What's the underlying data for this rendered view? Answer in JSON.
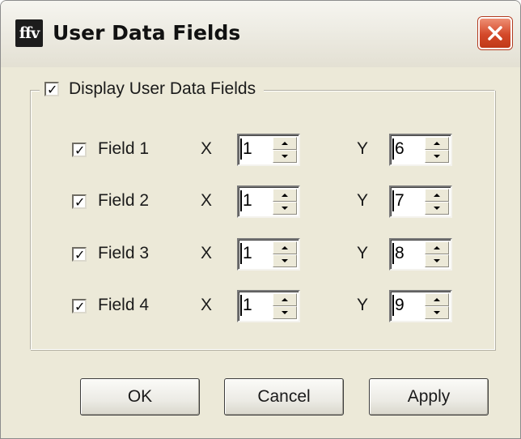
{
  "window": {
    "title": "User Data Fields",
    "app_icon_text": "ffv",
    "close_icon": "close-x-icon"
  },
  "group": {
    "label": "Display User Data Fields",
    "checked": true,
    "check_mark": "✓"
  },
  "labels": {
    "x": "X",
    "y": "Y"
  },
  "fields": [
    {
      "label": "Field 1",
      "checked": true,
      "x": "1",
      "y": "6"
    },
    {
      "label": "Field 2",
      "checked": true,
      "x": "1",
      "y": "7"
    },
    {
      "label": "Field 3",
      "checked": true,
      "x": "1",
      "y": "8"
    },
    {
      "label": "Field 4",
      "checked": true,
      "x": "1",
      "y": "9"
    }
  ],
  "buttons": {
    "ok": "OK",
    "cancel": "Cancel",
    "apply": "Apply"
  },
  "colors": {
    "dialog_bg": "#ece9d8",
    "close_button": "#d4492a"
  }
}
